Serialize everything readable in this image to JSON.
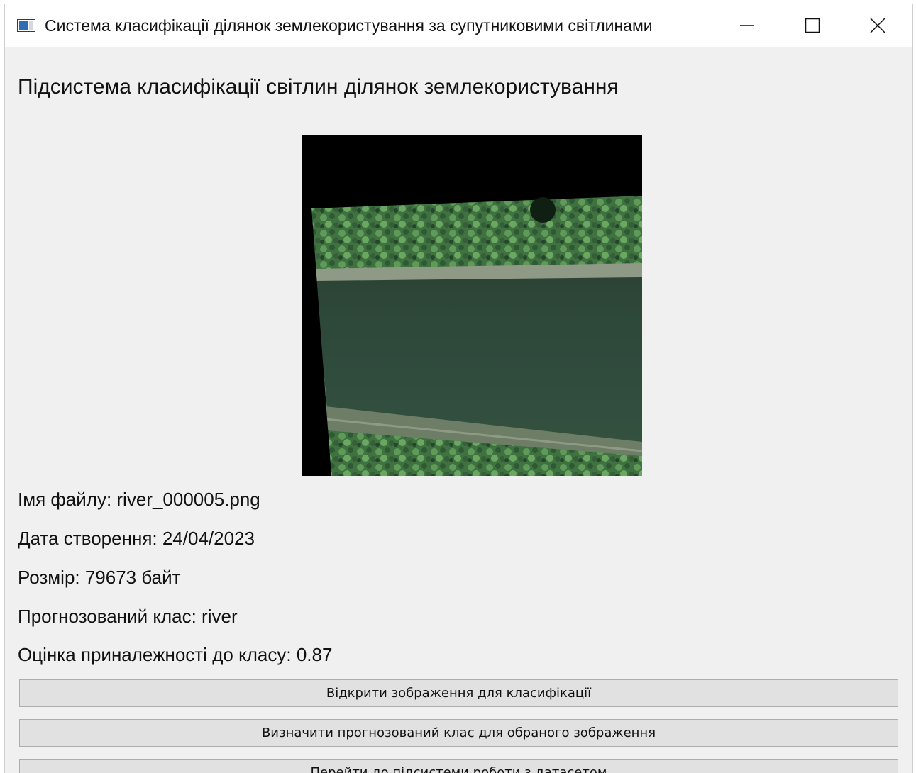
{
  "window": {
    "title": "Система класифікації ділянок землекористування за супутниковими світлинами"
  },
  "heading": "Підсистема класифікації світлин ділянок землекористування",
  "info": {
    "file_name": "Імя файлу: river_000005.png",
    "creation_date": "Дата створення: 24/04/2023",
    "size": "Розмір: 79673 байт",
    "predicted_class": "Прогнозований клас: river",
    "score": "Оцінка приналежності до класу: 0.87"
  },
  "buttons": {
    "open_image": "Відкрити зображення для класифікації",
    "predict_class": "Визначити прогнозований клас для обраного зображення",
    "go_dataset": "Перейти до підсистеми роботи з датасетом"
  },
  "colors": {
    "window_bg": "#f0f0f0",
    "button_bg": "#e1e1e1",
    "button_border": "#adadad",
    "river": "#2f4a3b",
    "vegetation": "#4f8a4a"
  }
}
